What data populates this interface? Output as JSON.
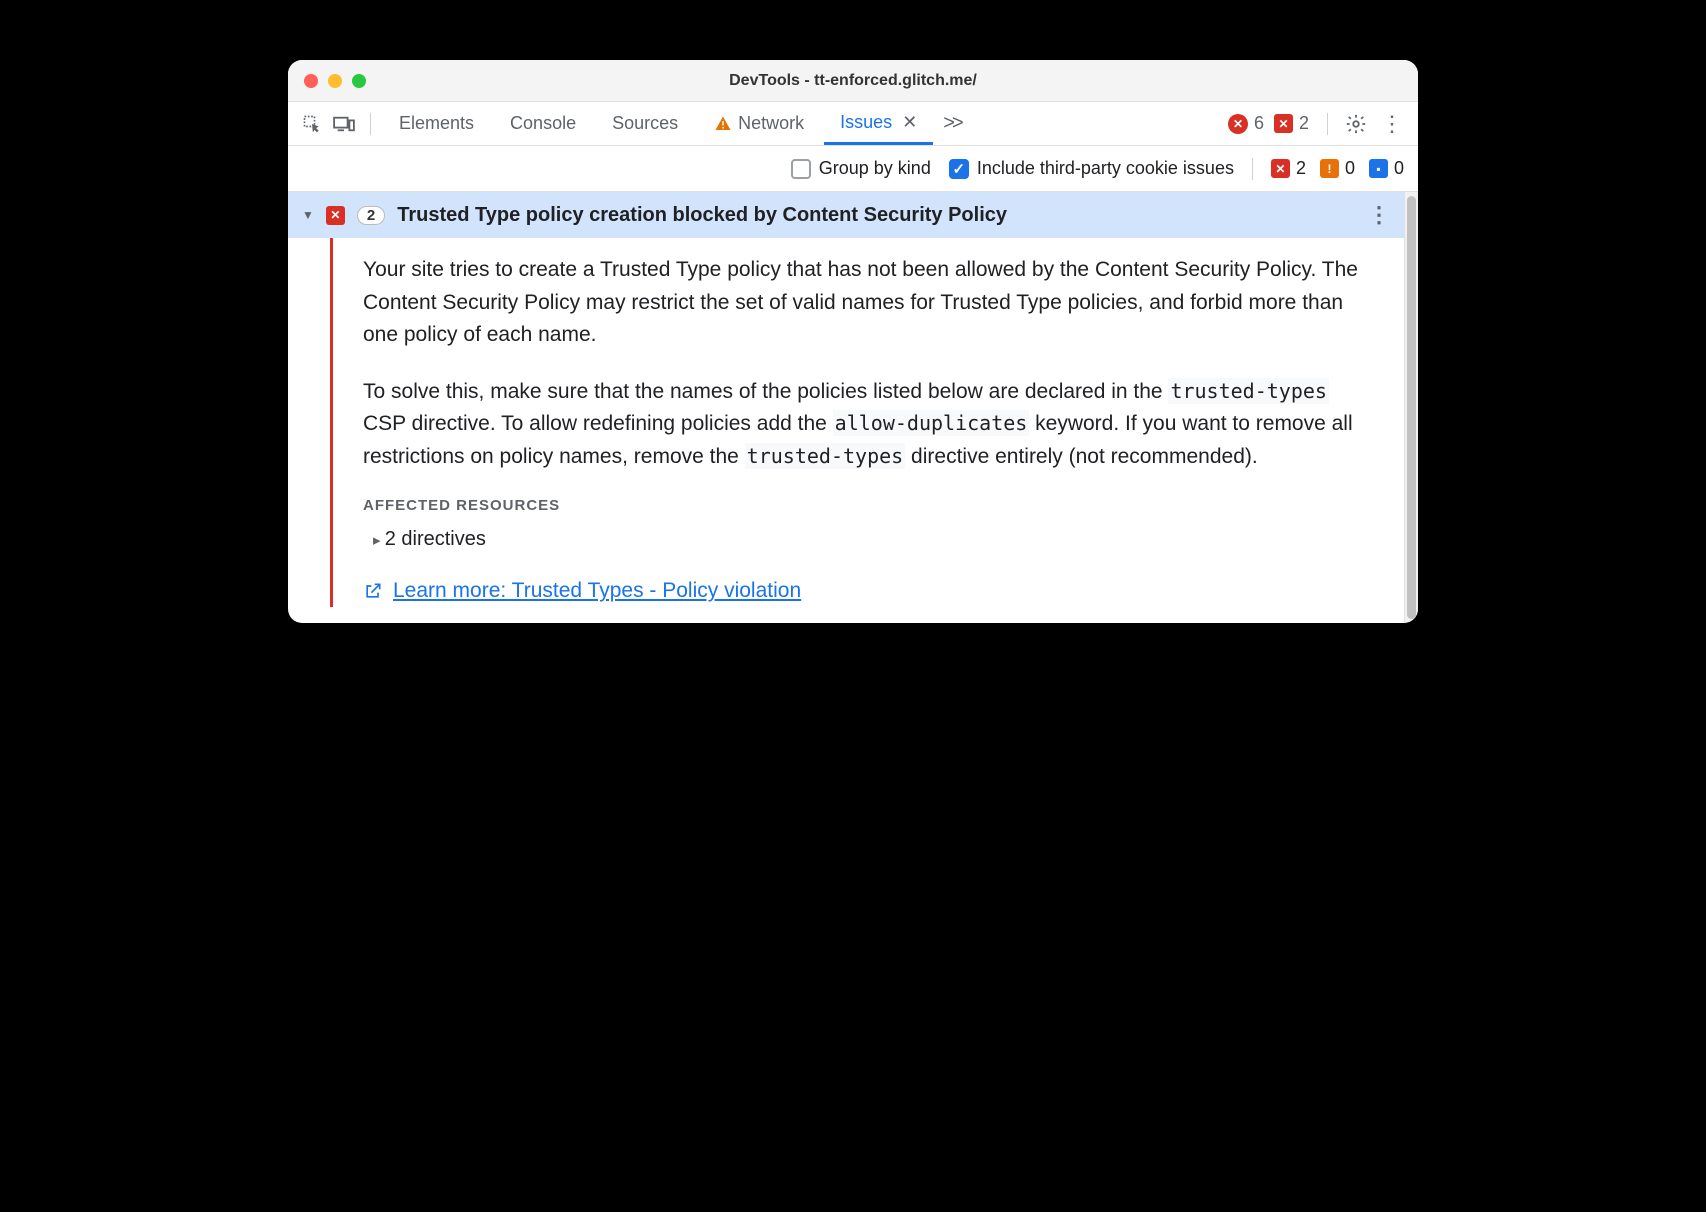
{
  "window": {
    "title": "DevTools - tt-enforced.glitch.me/"
  },
  "tabs": {
    "elements": "Elements",
    "console": "Console",
    "sources": "Sources",
    "network": "Network",
    "issues": "Issues"
  },
  "badges": {
    "errors": "6",
    "blocked": "2"
  },
  "toolbar": {
    "group_by_kind": "Group by kind",
    "include_third_party": "Include third-party cookie issues",
    "counts": {
      "red": "2",
      "orange": "0",
      "blue": "0"
    }
  },
  "issue": {
    "count": "2",
    "title": "Trusted Type policy creation blocked by Content Security Policy",
    "p1_a": "Your site tries to create a Trusted Type policy that has not been allowed by the Content Security Policy. The Content Security Policy may restrict the set of valid names for Trusted Type policies, and forbid more than one policy of each name.",
    "p2_a": "To solve this, make sure that the names of the policies listed below are declared in the ",
    "p2_code1": "trusted-types",
    "p2_b": " CSP directive. To allow redefining policies add the ",
    "p2_code2": "allow-duplicates",
    "p2_c": " keyword. If you want to remove all restrictions on policy names, remove the ",
    "p2_code3": "trusted-types",
    "p2_d": " directive entirely (not recommended).",
    "affected_label": "AFFECTED RESOURCES",
    "directives": "2 directives",
    "learn_more": "Learn more: Trusted Types - Policy violation"
  }
}
